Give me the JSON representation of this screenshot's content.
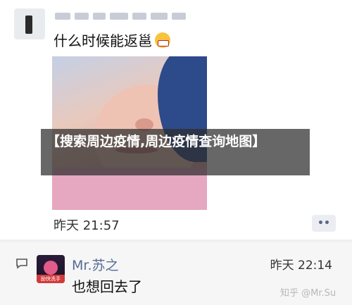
{
  "post": {
    "message": "什么时候能返邕",
    "emoji": "mask-face-icon",
    "time": "昨天 21:57",
    "more_label": "••"
  },
  "reply": {
    "name": "Mr.苏之",
    "time": "昨天 22:14",
    "message": "也想回去了",
    "avatar_tag": "励快洗手"
  },
  "overlay": {
    "title": "【搜索周边疫情,周边疫情查询地图】"
  },
  "watermark": "知乎 @Mr.Su"
}
